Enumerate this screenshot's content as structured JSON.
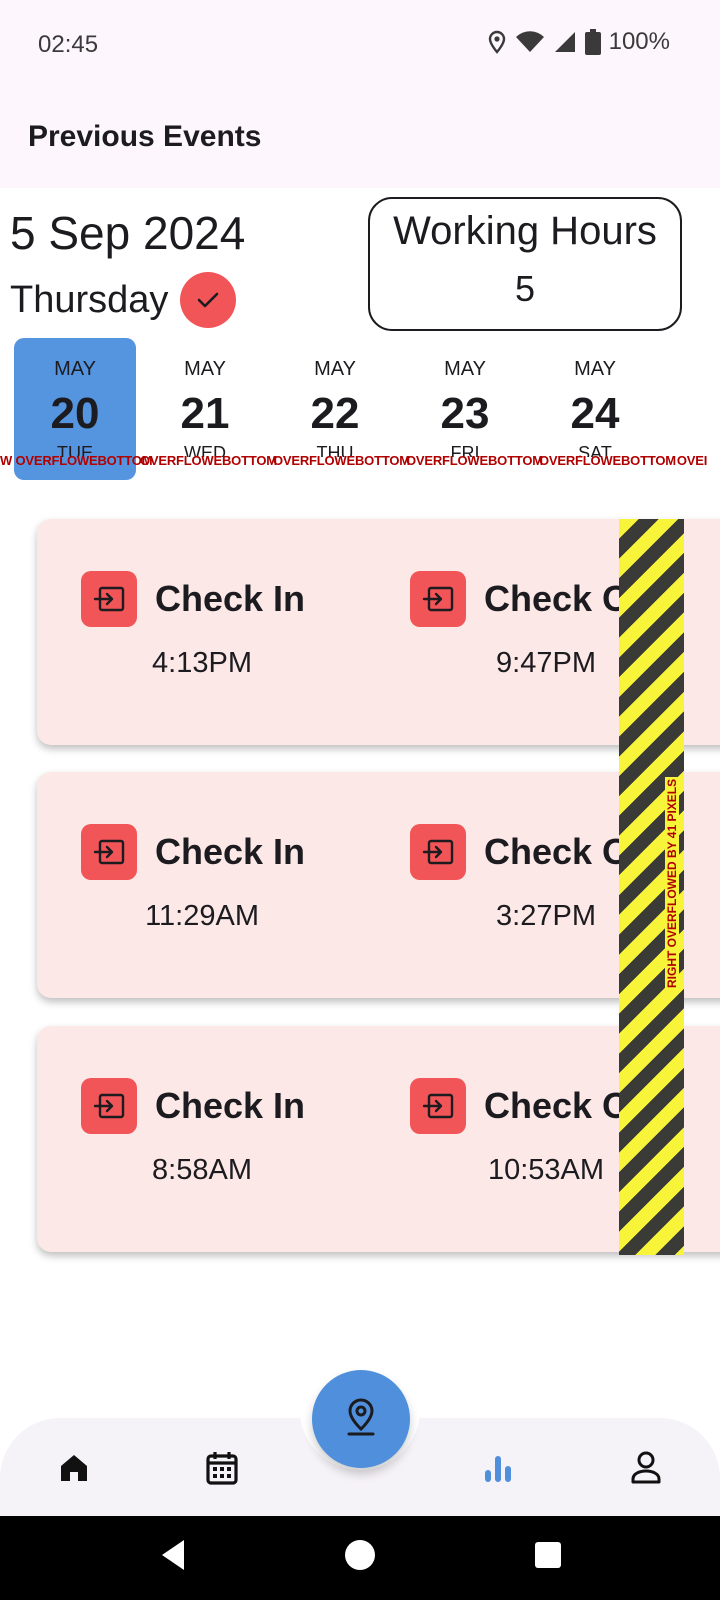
{
  "status_bar": {
    "time": "02:45",
    "battery": "100%"
  },
  "app_bar": {
    "title": "Previous Events"
  },
  "header": {
    "date": "5 Sep 2024",
    "weekday": "Thursday",
    "working_hours_label": "Working Hours",
    "working_hours_value": "5"
  },
  "date_strip": [
    {
      "month": "MAY",
      "day": "20",
      "weekday": "TUE",
      "selected": true
    },
    {
      "month": "MAY",
      "day": "21",
      "weekday": "WED",
      "selected": false
    },
    {
      "month": "MAY",
      "day": "22",
      "weekday": "THU",
      "selected": false
    },
    {
      "month": "MAY",
      "day": "23",
      "weekday": "FRI",
      "selected": false
    },
    {
      "month": "MAY",
      "day": "24",
      "weekday": "SAT",
      "selected": false
    }
  ],
  "overflow_text": [
    "W OVERFLOWEBOTTOM",
    "OVERFLOWEBOTTOM",
    "OVERFLOWEBOTTOM",
    "OVERFLOWEBOTTOM",
    "OVERFLOWEBOTTOM",
    "OVEI"
  ],
  "overflow_right_text": "RIGHT OVERFLOWED BY 41 PIXELS",
  "events": [
    {
      "check_in_label": "Check In",
      "check_in_time": "4:13PM",
      "check_out_label": "Check Out",
      "check_out_time": "9:47PM"
    },
    {
      "check_in_label": "Check In",
      "check_in_time": "11:29AM",
      "check_out_label": "Check Out",
      "check_out_time": "3:27PM"
    },
    {
      "check_in_label": "Check In",
      "check_in_time": "8:58AM",
      "check_out_label": "Check Out",
      "check_out_time": "10:53AM"
    }
  ],
  "nav": {
    "items": [
      "home-icon",
      "calendar-icon",
      "bar-chart-icon",
      "profile-icon"
    ],
    "fab": "location-pin-icon",
    "active": "bar-chart-icon"
  },
  "colors": {
    "accent_blue": "#4f8fdc",
    "accent_red": "#f15558",
    "card_bg": "#fde8e8",
    "app_bar_bg": "#fdf6fc"
  }
}
